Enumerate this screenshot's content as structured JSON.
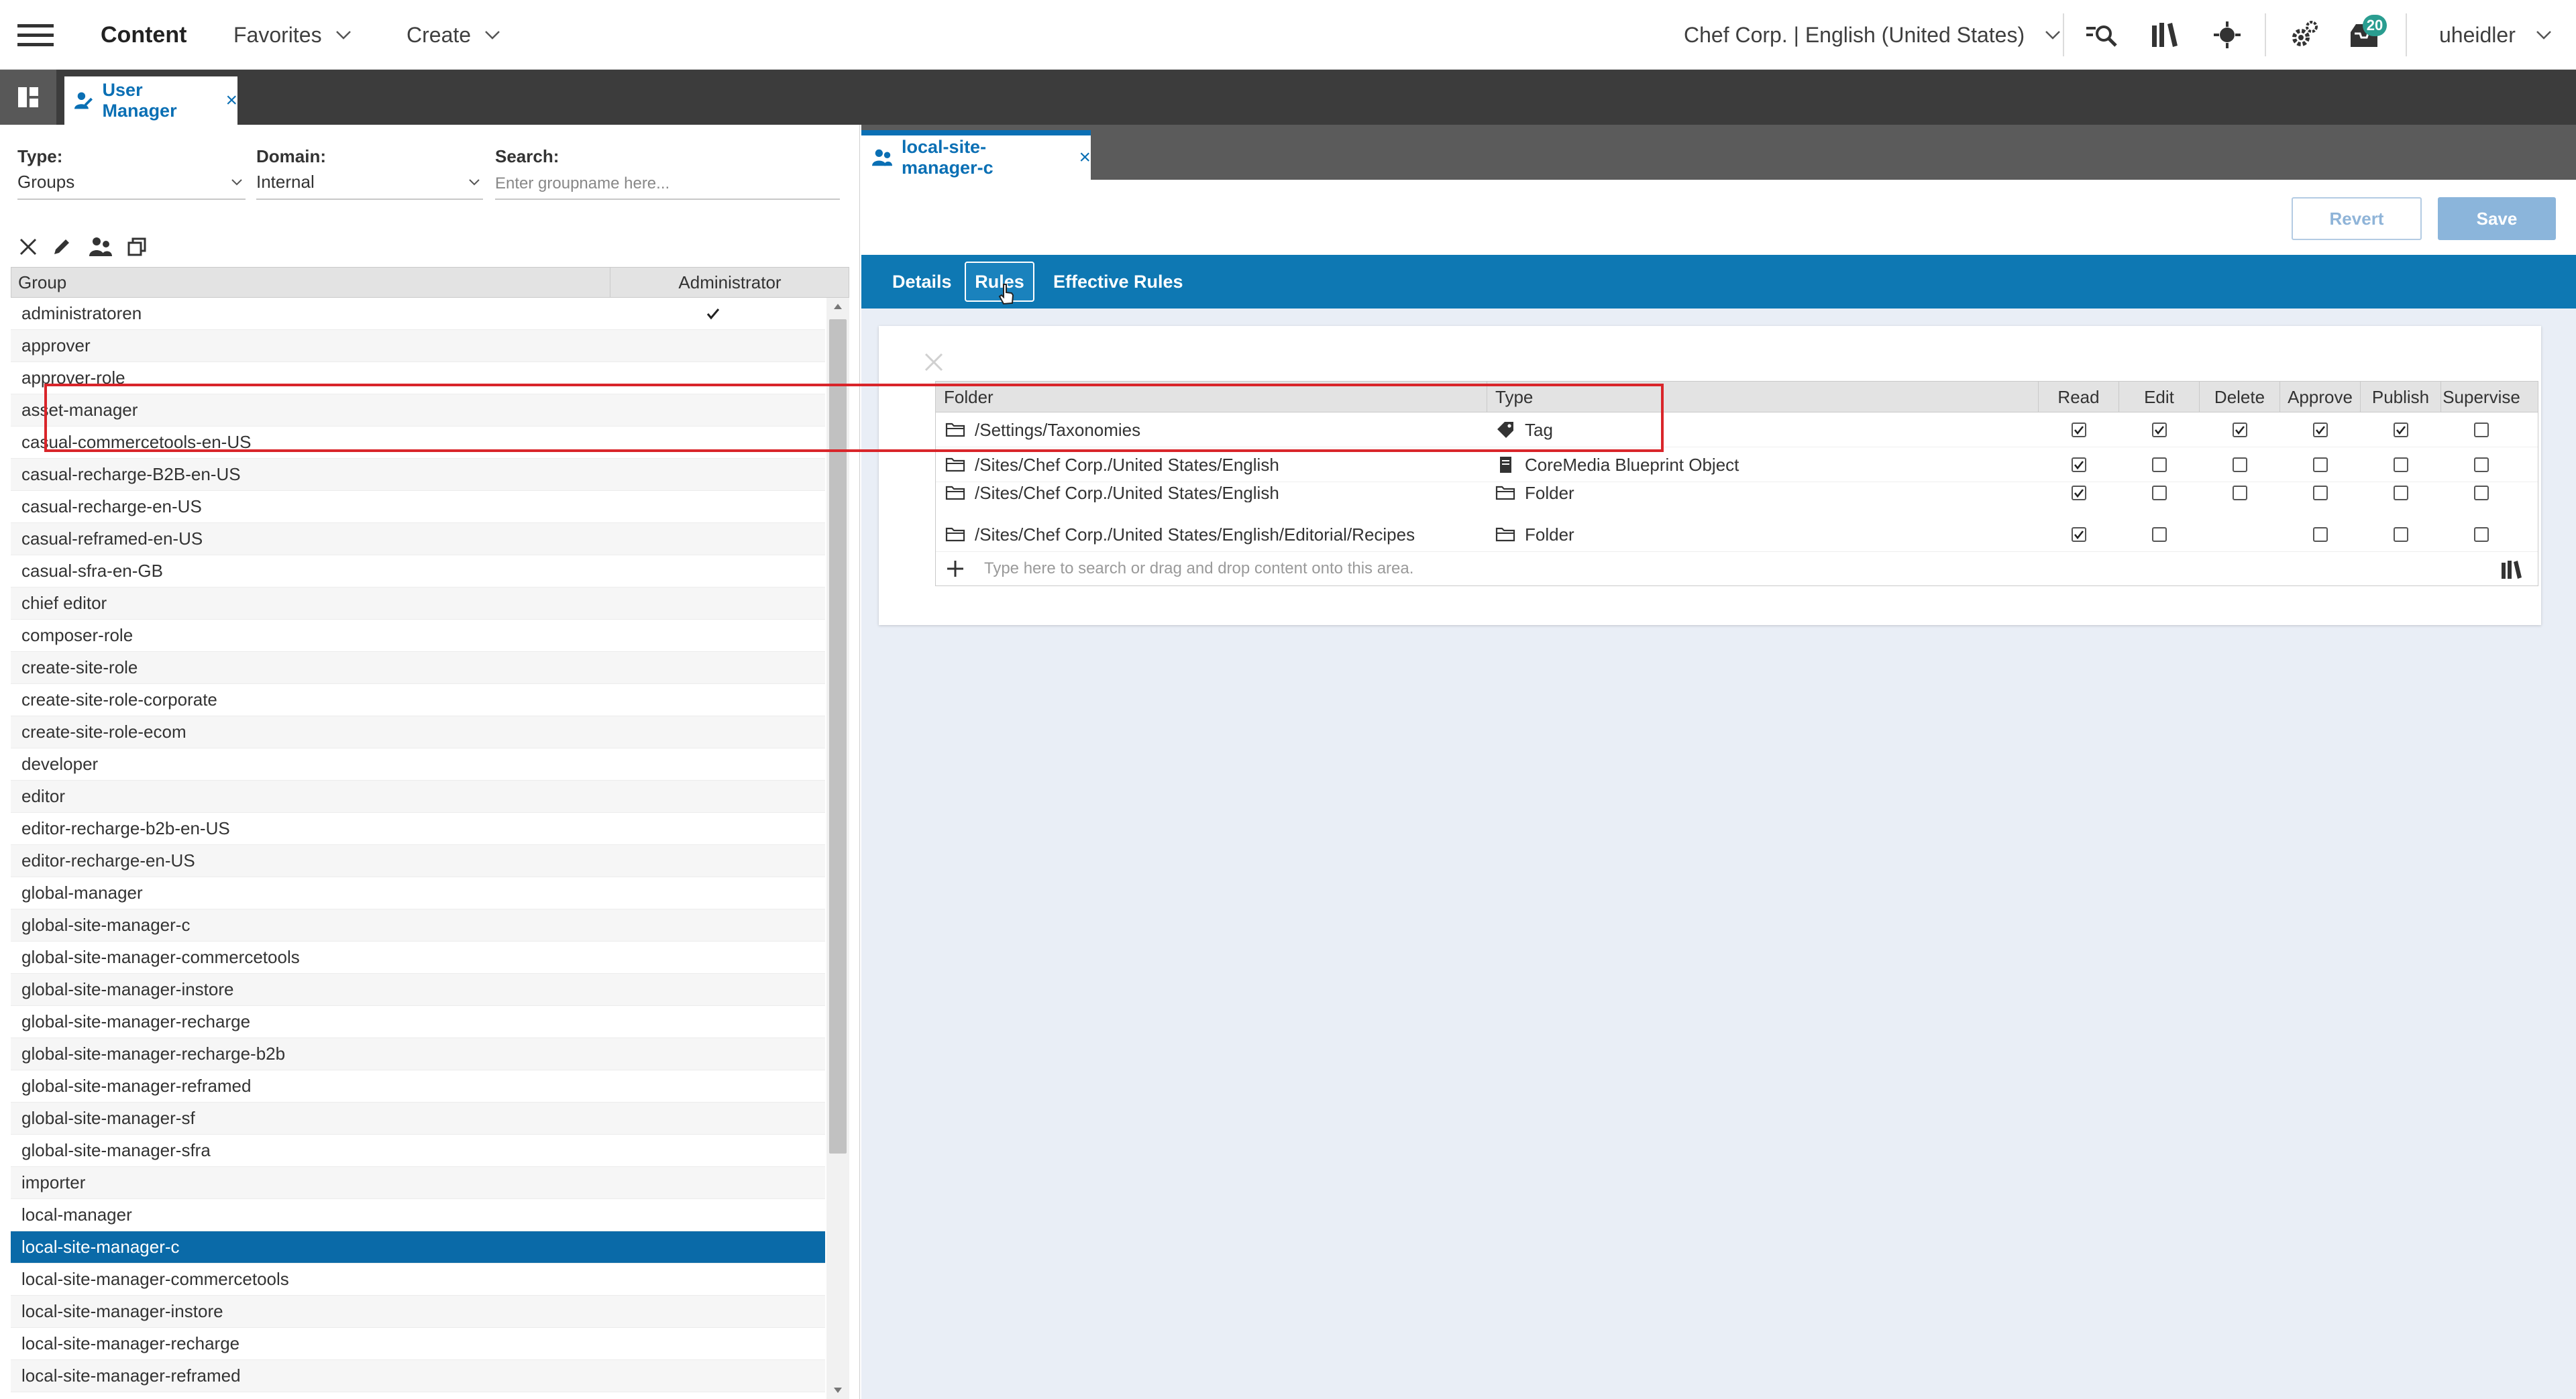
{
  "topbar": {
    "title": "Content",
    "favorites": "Favorites",
    "create": "Create",
    "site_selector": "Chef Corp. | English (United States)",
    "notification_count": "20",
    "user": "uheidler"
  },
  "tabs": {
    "user_manager": "User Manager",
    "group_editor": "local-site-manager-c"
  },
  "filters": {
    "type_label": "Type:",
    "type_value": "Groups",
    "domain_label": "Domain:",
    "domain_value": "Internal",
    "search_label": "Search:",
    "search_placeholder": "Enter groupname here..."
  },
  "group_table": {
    "col_group": "Group",
    "col_admin": "Administrator",
    "rows": [
      {
        "name": "administratoren",
        "admin": true
      },
      {
        "name": "approver",
        "admin": false
      },
      {
        "name": "approver-role",
        "admin": false
      },
      {
        "name": "asset-manager",
        "admin": false
      },
      {
        "name": "casual-commercetools-en-US",
        "admin": false
      },
      {
        "name": "casual-recharge-B2B-en-US",
        "admin": false
      },
      {
        "name": "casual-recharge-en-US",
        "admin": false
      },
      {
        "name": "casual-reframed-en-US",
        "admin": false
      },
      {
        "name": "casual-sfra-en-GB",
        "admin": false
      },
      {
        "name": "chief editor",
        "admin": false
      },
      {
        "name": "composer-role",
        "admin": false
      },
      {
        "name": "create-site-role",
        "admin": false
      },
      {
        "name": "create-site-role-corporate",
        "admin": false
      },
      {
        "name": "create-site-role-ecom",
        "admin": false
      },
      {
        "name": "developer",
        "admin": false
      },
      {
        "name": "editor",
        "admin": false
      },
      {
        "name": "editor-recharge-b2b-en-US",
        "admin": false
      },
      {
        "name": "editor-recharge-en-US",
        "admin": false
      },
      {
        "name": "global-manager",
        "admin": false
      },
      {
        "name": "global-site-manager-c",
        "admin": false
      },
      {
        "name": "global-site-manager-commercetools",
        "admin": false
      },
      {
        "name": "global-site-manager-instore",
        "admin": false
      },
      {
        "name": "global-site-manager-recharge",
        "admin": false
      },
      {
        "name": "global-site-manager-recharge-b2b",
        "admin": false
      },
      {
        "name": "global-site-manager-reframed",
        "admin": false
      },
      {
        "name": "global-site-manager-sf",
        "admin": false
      },
      {
        "name": "global-site-manager-sfra",
        "admin": false
      },
      {
        "name": "importer",
        "admin": false
      },
      {
        "name": "local-manager",
        "admin": false
      },
      {
        "name": "local-site-manager-c",
        "admin": false,
        "selected": true
      },
      {
        "name": "local-site-manager-commercetools",
        "admin": false
      },
      {
        "name": "local-site-manager-instore",
        "admin": false
      },
      {
        "name": "local-site-manager-recharge",
        "admin": false
      },
      {
        "name": "local-site-manager-reframed",
        "admin": false
      }
    ]
  },
  "editor": {
    "revert": "Revert",
    "save": "Save",
    "tab_details": "Details",
    "tab_rules": "Rules",
    "tab_effective": "Effective Rules"
  },
  "rules_table": {
    "col_folder": "Folder",
    "col_type": "Type",
    "permissions": [
      "Read",
      "Edit",
      "Delete",
      "Approve",
      "Publish",
      "Supervise"
    ],
    "rows": [
      {
        "folder": "/Settings/Taxonomies",
        "type": "Tag",
        "type_icon": "tag-icon",
        "perms": [
          true,
          true,
          true,
          true,
          true,
          false
        ]
      },
      {
        "folder": "/Sites/Chef Corp./United States/English",
        "type": "CoreMedia Blueprint Object",
        "type_icon": "document-icon",
        "perms": [
          true,
          false,
          false,
          false,
          false,
          false
        ]
      },
      {
        "folder": "/Sites/Chef Corp./United States/English",
        "type": "Folder",
        "type_icon": "folder-icon",
        "perms": [
          true,
          false,
          false,
          false,
          false,
          false
        ],
        "partial": true
      },
      {
        "folder": "/Sites/Chef Corp./United States/English/Editorial/Recipes",
        "type": "Folder",
        "type_icon": "folder-icon",
        "perms": [
          true,
          false,
          null,
          false,
          false,
          false
        ],
        "highlighted": true
      }
    ],
    "drop_placeholder": "Type here to search or drag and drop content onto this area."
  },
  "colors": {
    "accent": "#0e78b3",
    "selected_row": "#0a6aa8",
    "highlight": "#d9252a"
  }
}
